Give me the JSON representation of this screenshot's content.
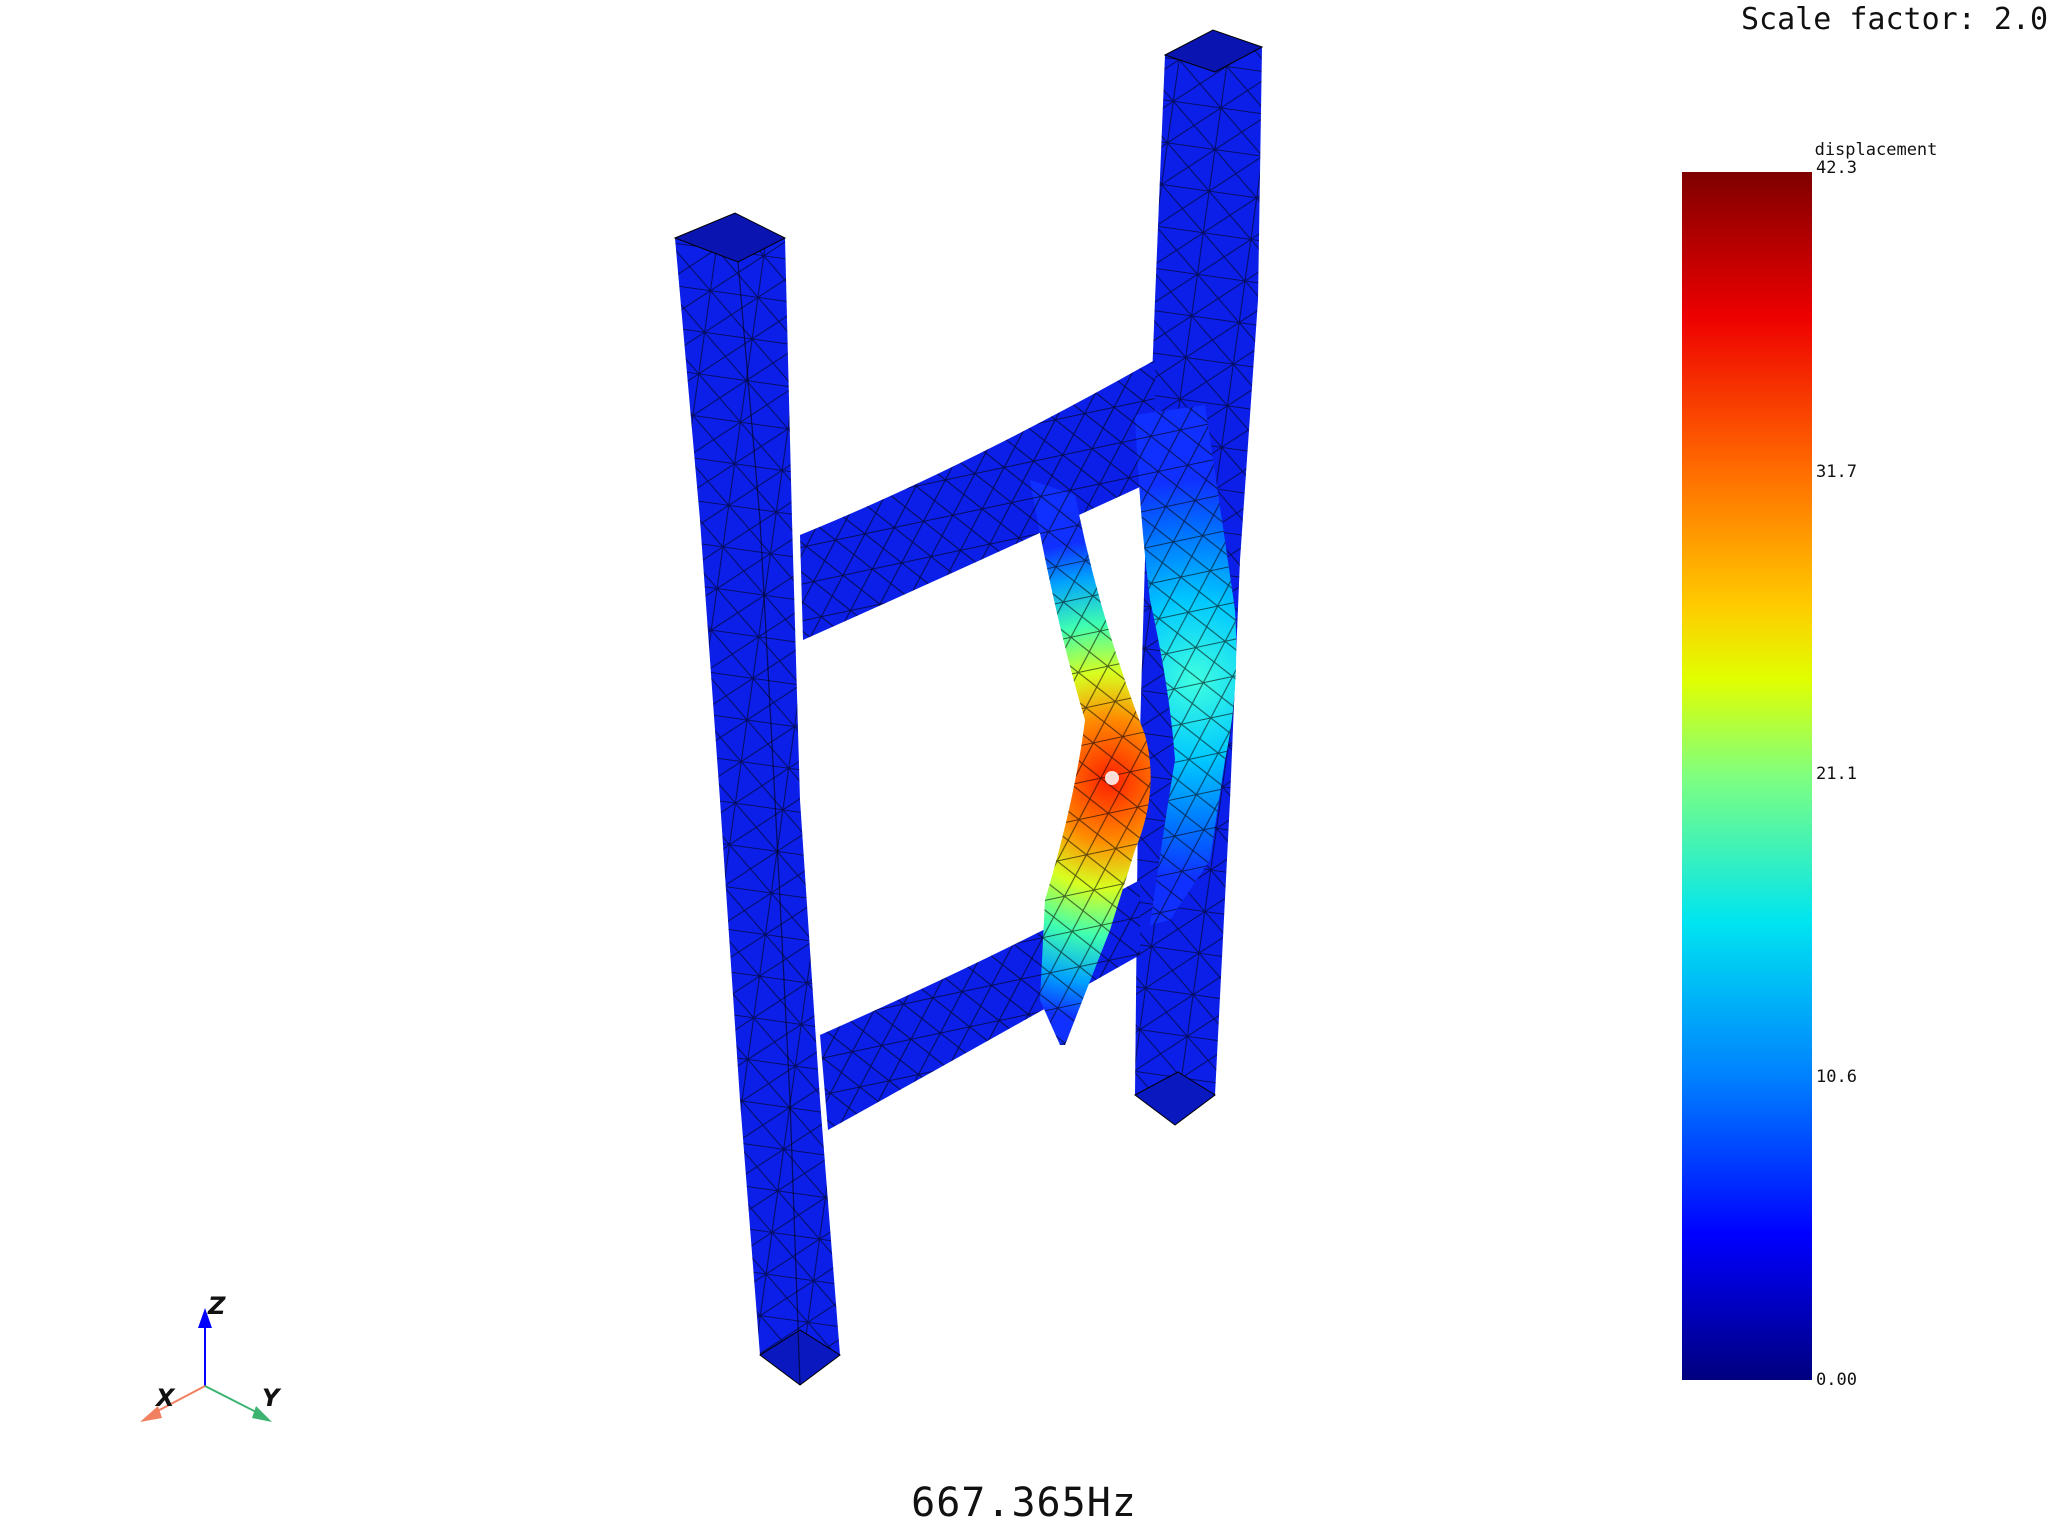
{
  "viewer": {
    "scale_factor_label": "Scale factor: 2.0",
    "frequency_label": "667.365Hz"
  },
  "colorbar": {
    "title": "displacement",
    "ticks": [
      "42.3",
      "31.7",
      "21.1",
      "10.6",
      "0.00"
    ],
    "colormap": [
      "#7f0000",
      "#ee0000",
      "#ff6600",
      "#ffcc00",
      "#e0ff00",
      "#7fff7f",
      "#00e5f0",
      "#0080ff",
      "#0000ff",
      "#00007f"
    ]
  },
  "axes_triad": {
    "z_label": "Z",
    "x_label": "X",
    "y_label": "Y",
    "x_color": "#f08060",
    "y_color": "#3cb371",
    "z_color": "#0000ff"
  },
  "model": {
    "base_color": "#0a1ee8",
    "mesh_color": "#000000",
    "description_icon": "fem-mesh-ladder"
  }
}
